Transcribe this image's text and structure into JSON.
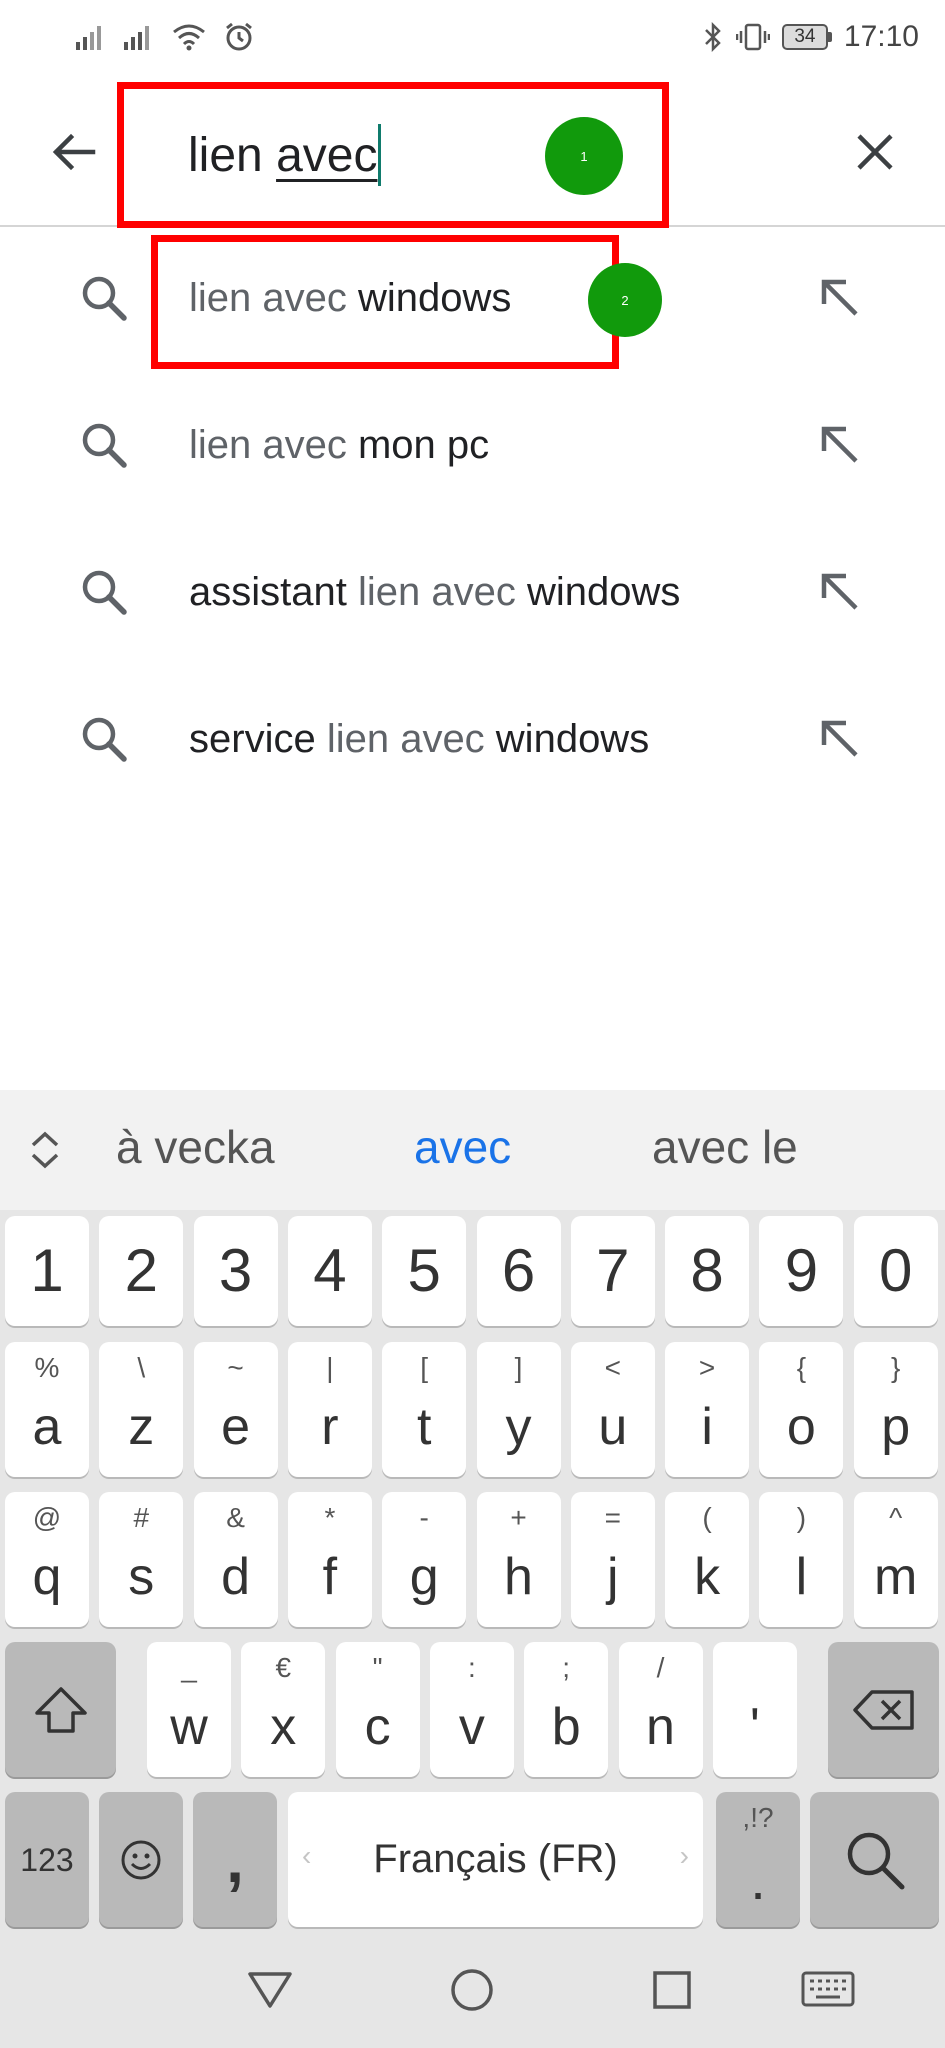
{
  "status_bar": {
    "time": "17:10",
    "battery": "34",
    "icons": [
      "signal-icon",
      "signal-icon",
      "wifi-icon",
      "alarm-icon",
      "bluetooth-icon",
      "vibrate-icon",
      "battery-icon"
    ]
  },
  "search": {
    "query_plain": "lien ",
    "query_underlined": "avec",
    "back_icon": "arrow-back-icon",
    "clear_icon": "close-icon"
  },
  "suggestions": [
    {
      "parts": [
        {
          "text": "lien avec ",
          "style": "typed"
        },
        {
          "text": "windows",
          "style": "completion"
        }
      ]
    },
    {
      "parts": [
        {
          "text": "lien avec ",
          "style": "typed"
        },
        {
          "text": "mon pc",
          "style": "completion"
        }
      ]
    },
    {
      "parts": [
        {
          "text": "assistant ",
          "style": "completion"
        },
        {
          "text": "lien avec ",
          "style": "typed"
        },
        {
          "text": "windows",
          "style": "completion"
        }
      ]
    },
    {
      "parts": [
        {
          "text": "service ",
          "style": "completion"
        },
        {
          "text": "lien avec ",
          "style": "typed"
        },
        {
          "text": "windows",
          "style": "completion"
        }
      ]
    }
  ],
  "annotations": {
    "marker_1": "1",
    "marker_2": "2"
  },
  "keyboard": {
    "suggestions": [
      "à vecka",
      "avec",
      "avec le"
    ],
    "active_suggestion": "avec",
    "number_row": [
      "1",
      "2",
      "3",
      "4",
      "5",
      "6",
      "7",
      "8",
      "9",
      "0"
    ],
    "row1": [
      {
        "main": "a",
        "alt": "%"
      },
      {
        "main": "z",
        "alt": "\\"
      },
      {
        "main": "e",
        "alt": "~"
      },
      {
        "main": "r",
        "alt": "|"
      },
      {
        "main": "t",
        "alt": "["
      },
      {
        "main": "y",
        "alt": "]"
      },
      {
        "main": "u",
        "alt": "<"
      },
      {
        "main": "i",
        "alt": ">"
      },
      {
        "main": "o",
        "alt": "{"
      },
      {
        "main": "p",
        "alt": "}"
      }
    ],
    "row2": [
      {
        "main": "q",
        "alt": "@"
      },
      {
        "main": "s",
        "alt": "#"
      },
      {
        "main": "d",
        "alt": "&"
      },
      {
        "main": "f",
        "alt": "*"
      },
      {
        "main": "g",
        "alt": "-"
      },
      {
        "main": "h",
        "alt": "+"
      },
      {
        "main": "j",
        "alt": "="
      },
      {
        "main": "k",
        "alt": "("
      },
      {
        "main": "l",
        "alt": ")"
      },
      {
        "main": "m",
        "alt": "^"
      }
    ],
    "row3": [
      {
        "main": "w",
        "alt": "_"
      },
      {
        "main": "x",
        "alt": "€"
      },
      {
        "main": "c",
        "alt": "\""
      },
      {
        "main": "v",
        "alt": ":"
      },
      {
        "main": "b",
        "alt": ";"
      },
      {
        "main": "n",
        "alt": "/"
      },
      {
        "main": "'",
        "alt": ""
      }
    ],
    "key_123": "123",
    "key_comma": ",",
    "space_label": "Français (FR)",
    "punct_alt": ",!?",
    "punct_main": "."
  },
  "nav_bar": {
    "items": [
      "back-triangle-icon",
      "home-circle-icon",
      "recents-square-icon",
      "keyboard-icon"
    ]
  }
}
